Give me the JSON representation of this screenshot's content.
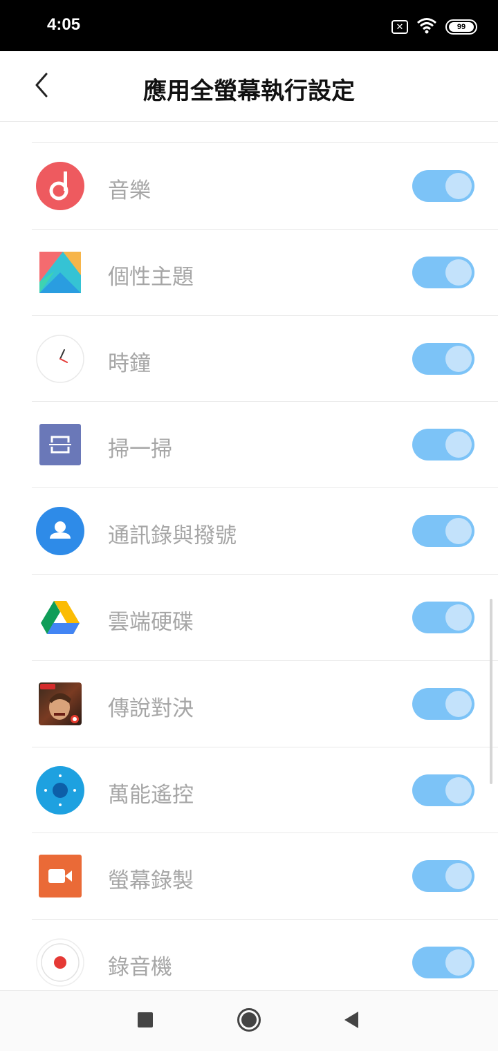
{
  "status_bar": {
    "time": "4:05",
    "notification_icon": "close-box-icon",
    "notification_glyph": "✕",
    "wifi_icon": "wifi-icon",
    "battery_level": "99"
  },
  "header": {
    "back_icon": "back-chevron-icon",
    "title": "應用全螢幕執行設定"
  },
  "apps": [
    {
      "label": "音樂",
      "icon": "music-app-icon",
      "enabled": true
    },
    {
      "label": "個性主題",
      "icon": "themes-app-icon",
      "enabled": true
    },
    {
      "label": "時鐘",
      "icon": "clock-app-icon",
      "enabled": true
    },
    {
      "label": "掃一掃",
      "icon": "scanner-app-icon",
      "enabled": true
    },
    {
      "label": "通訊錄與撥號",
      "icon": "contacts-app-icon",
      "enabled": true
    },
    {
      "label": "雲端硬碟",
      "icon": "drive-app-icon",
      "enabled": true
    },
    {
      "label": "傳說對決",
      "icon": "game-app-icon",
      "enabled": true
    },
    {
      "label": "萬能遙控",
      "icon": "remote-app-icon",
      "enabled": true
    },
    {
      "label": "螢幕錄製",
      "icon": "screen-recorder-app-icon",
      "enabled": true
    },
    {
      "label": "錄音機",
      "icon": "voice-recorder-app-icon",
      "enabled": true
    }
  ],
  "colors": {
    "toggle_on": "#7cc3f7",
    "toggle_knob": "#c3e2fb",
    "label_text": "#a6a6a6"
  },
  "nav_bar": {
    "recents_icon": "square-recents-icon",
    "home_icon": "circle-home-icon",
    "back_icon": "triangle-back-icon"
  }
}
